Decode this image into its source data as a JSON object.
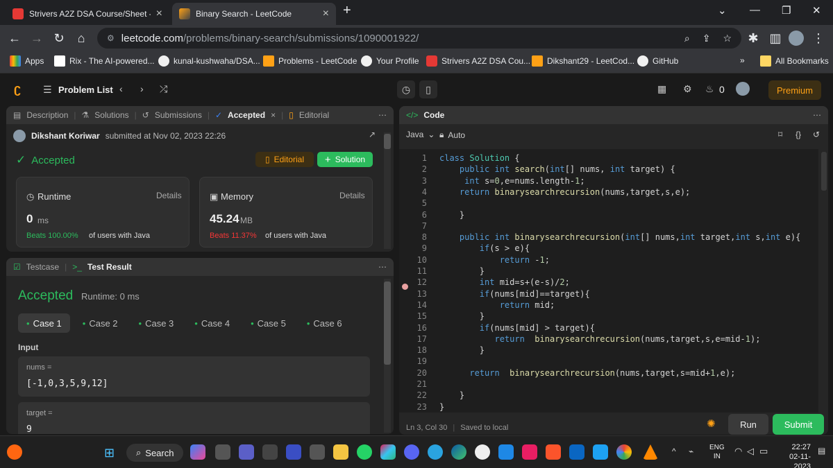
{
  "browser": {
    "tabs": [
      {
        "title": "Strivers A2Z DSA Course/Sheet - Cr",
        "favicon": "tuf-icon"
      },
      {
        "title": "Binary Search - LeetCode",
        "favicon": "leetcode-icon"
      }
    ],
    "url_host": "leetcode.com",
    "url_path": "/problems/binary-search/submissions/1090001922/",
    "bookmarks": [
      "Apps",
      "Rix - The AI-powered...",
      "kunal-kushwaha/DSA...",
      "Problems - LeetCode",
      "Your Profile",
      "Strivers A2Z DSA Cou...",
      "Dikshant29 - LeetCod...",
      "GitHub"
    ],
    "bookmarks_more": "»",
    "all_bookmarks": "All Bookmarks"
  },
  "lc": {
    "problem_list": "Problem List",
    "streak": "0",
    "premium": "Premium",
    "left_tabs": [
      "Description",
      "Solutions",
      "Submissions",
      "Accepted",
      "Editorial"
    ],
    "submitter": "Dikshant Koriwar",
    "submitted_at": "submitted at Nov 02, 2023 22:26",
    "status": "Accepted",
    "editorial_btn": "Editorial",
    "solution_btn": "Solution",
    "runtime": {
      "label": "Runtime",
      "details": "Details",
      "value": "0",
      "unit": "ms",
      "beats_label": "Beats",
      "beats_pct": "100.00%",
      "beats_rest": "of users with Java"
    },
    "memory": {
      "label": "Memory",
      "details": "Details",
      "value": "45.24",
      "unit": "MB",
      "beats_label": "Beats",
      "beats_pct": "11.37%",
      "beats_rest": "of users with Java"
    },
    "bottom_tabs": {
      "testcase": "Testcase",
      "result": "Test Result"
    },
    "result_status": "Accepted",
    "result_runtime": "Runtime: 0 ms",
    "cases": [
      "Case 1",
      "Case 2",
      "Case 3",
      "Case 4",
      "Case 5",
      "Case 6"
    ],
    "input_label": "Input",
    "nums_label": "nums =",
    "nums_value": "[-1,0,3,5,9,12]",
    "target_label": "target =",
    "target_value": "9",
    "code_tab": "Code",
    "lang": "Java",
    "mode": "Auto",
    "status_pos": "Ln 3, Col 30",
    "status_saved": "Saved to local",
    "run": "Run",
    "submit": "Submit"
  },
  "code_lines": [
    "class Solution {",
    "    public int search(int[] nums, int target) {",
    "     int s=0,e=nums.length-1;",
    "    return binarysearchrecursion(nums,target,s,e);",
    "",
    "    }",
    "",
    "    public int binarysearchrecursion(int[] nums,int target,int s,int e){",
    "        if(s > e){",
    "            return -1;",
    "        }",
    "        int mid=s+(e-s)/2;",
    "        if(nums[mid]==target){",
    "            return mid;",
    "        }",
    "        if(nums[mid] > target){",
    "           return  binarysearchrecursion(nums,target,s,e=mid-1);",
    "        }",
    "",
    "      return  binarysearchrecursion(nums,target,s=mid+1,e);",
    "",
    "    }",
    "}"
  ],
  "taskbar": {
    "search": "Search",
    "lang": "ENG",
    "region": "IN",
    "time": "22:27",
    "date": "02-11-2023"
  },
  "colors": {
    "accent_green": "#2cbb5d",
    "premium_orange": "#ffa116",
    "beats_red": "#f63636"
  }
}
